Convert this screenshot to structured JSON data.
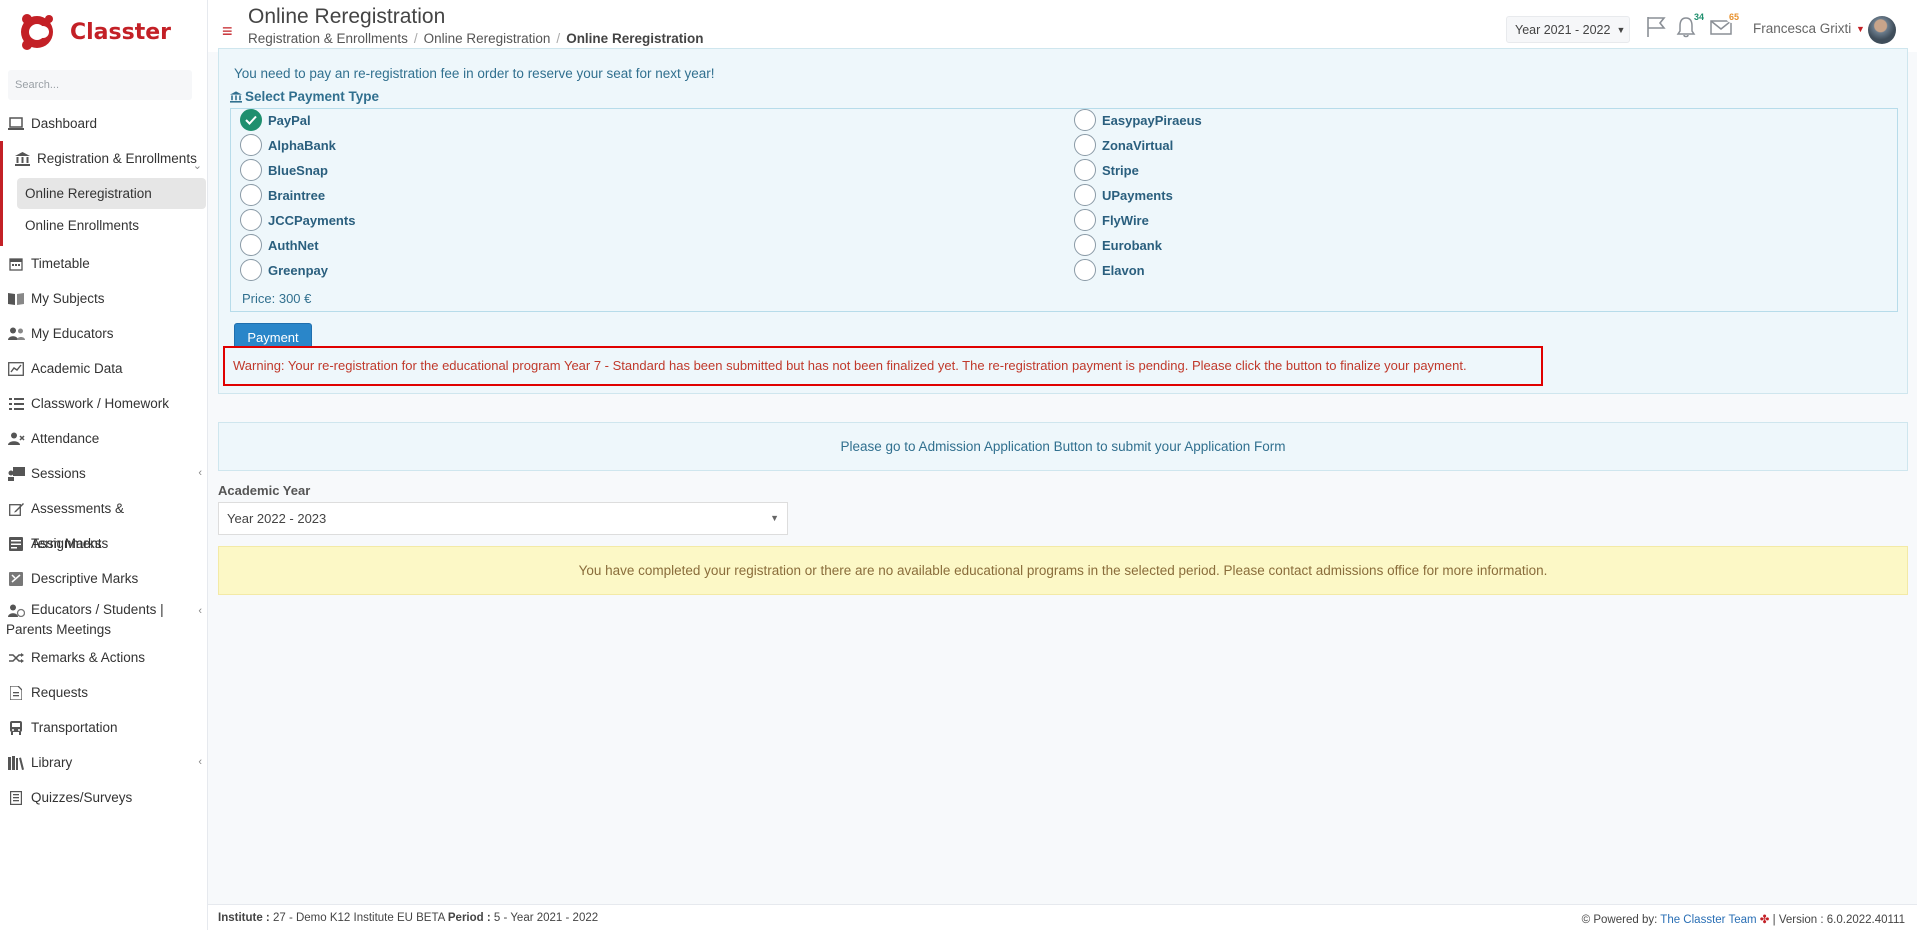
{
  "app": {
    "name": "Classter"
  },
  "search": {
    "placeholder": "Search..."
  },
  "sidebar": {
    "items": [
      {
        "label": "Dashboard",
        "icon": "laptop-icon"
      },
      {
        "label": "Registration & Enrollments",
        "icon": "bank-icon"
      },
      {
        "label": "Timetable",
        "icon": "calendar-icon"
      },
      {
        "label": "My Subjects",
        "icon": "book-icon"
      },
      {
        "label": "My Educators",
        "icon": "users-icon"
      },
      {
        "label": "Academic Data",
        "icon": "chart-icon"
      },
      {
        "label": "Classwork / Homework",
        "icon": "list-icon"
      },
      {
        "label": "Attendance",
        "icon": "user-x-icon"
      },
      {
        "label": "Sessions",
        "icon": "presentation-icon"
      },
      {
        "label": "Assessments & Assignments",
        "icon": "edit-icon"
      },
      {
        "label": "Term Marks",
        "icon": "marks-icon"
      },
      {
        "label": "Descriptive Marks",
        "icon": "descriptive-icon"
      },
      {
        "label": "Educators / Students | Parents Meetings",
        "icon": "meeting-icon"
      },
      {
        "label": "Remarks & Actions",
        "icon": "shuffle-icon"
      },
      {
        "label": "Requests",
        "icon": "document-icon"
      },
      {
        "label": "Transportation",
        "icon": "bus-icon"
      },
      {
        "label": "Library",
        "icon": "library-icon"
      },
      {
        "label": "Quizzes/Surveys",
        "icon": "survey-icon"
      }
    ],
    "subitems": [
      {
        "label": "Online Reregistration"
      },
      {
        "label": "Online Enrollments"
      }
    ]
  },
  "header": {
    "title": "Online Reregistration",
    "breadcrumb": [
      "Registration & Enrollments",
      "Online Reregistration",
      "Online Reregistration"
    ],
    "year": "Year 2021 - 2022",
    "notifications_count": "34",
    "messages_count": "65",
    "user_name": "Francesca Grixti"
  },
  "main": {
    "fee_message": "You need to pay an re-registration fee in order to reserve your seat for next year!",
    "payment_type_label": "Select Payment Type",
    "options_left": [
      "PayPal",
      "AlphaBank",
      "BlueSnap",
      "Braintree",
      "JCCPayments",
      "AuthNet",
      "Greenpay"
    ],
    "options_right": [
      "EasypayPiraeus",
      "ZonaVirtual",
      "Stripe",
      "UPayments",
      "FlyWire",
      "Eurobank",
      "Elavon"
    ],
    "selected_option": "PayPal",
    "price": "Price: 300 €",
    "payment_button": "Payment",
    "warning": "Warning: Your re-registration for the educational program Year 7 - Standard has been submitted but has not been finalized yet. The re-registration payment is pending. Please click the button to finalize your payment.",
    "info_message": "Please go to Admission Application Button to submit your Application Form",
    "academic_year_label": "Academic Year",
    "academic_year_value": "Year 2022 - 2023",
    "notice": "You have completed your registration or there are no available educational programs in the selected period. Please contact admissions office for more information."
  },
  "footer": {
    "institute_label": "Institute :",
    "institute_value": "27 - Demo K12 Institute EU BETA",
    "period_label": "Period :",
    "period_value": "5 - Year 2021 - 2022",
    "powered_by": "Powered by:",
    "team": "The Classter Team",
    "version": "| Version : 6.0.2022.40111"
  },
  "colors": {
    "brand": "#c32026",
    "info_text": "#31708f",
    "warning_border": "#e00000",
    "selected_radio": "#1f8f6e",
    "primary_button": "#2a86c9",
    "notice_bg": "#fcf8c6"
  }
}
